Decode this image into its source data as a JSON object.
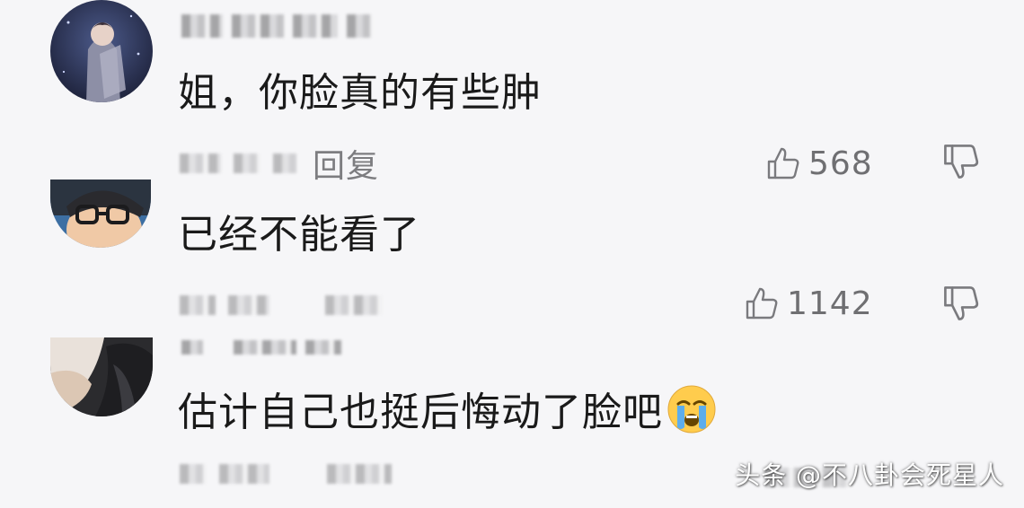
{
  "comments": [
    {
      "text": "姐，你脸真的有些肿",
      "reply_label": "回复",
      "likes": "568",
      "avatar_icon": "avatar-anime-icon"
    },
    {
      "text": "已经不能看了",
      "likes": "1142",
      "avatar_icon": "avatar-glasses-icon"
    },
    {
      "text": "估计自己也挺后悔动了脸吧",
      "emoji": "loudly-crying-face-emoji",
      "avatar_icon": "avatar-photo-icon"
    }
  ],
  "watermark": "头条 @不八卦会死星人",
  "colors": {
    "background": "#f6f6f8",
    "text": "#1a1a1a",
    "muted": "#7d7d80"
  }
}
